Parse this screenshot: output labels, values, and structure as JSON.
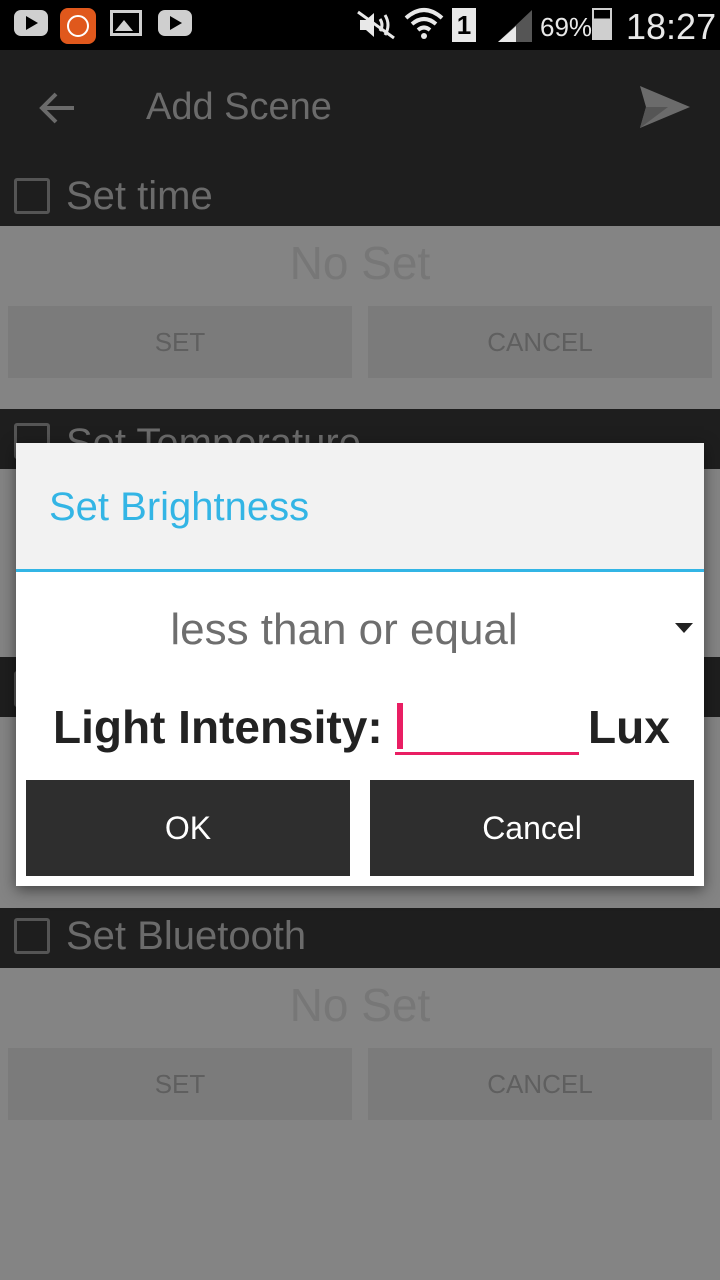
{
  "status_bar": {
    "battery_percent": "69%",
    "time": "18:27",
    "sim_slot": "1",
    "icons": [
      "youtube-icon",
      "mi-icon",
      "image-icon",
      "youtube-icon",
      "mute-icon",
      "wifi-icon",
      "sim-icon",
      "signal-icon",
      "battery-icon"
    ]
  },
  "app_bar": {
    "title": "Add Scene",
    "back_icon": "back-arrow-icon",
    "send_icon": "send-icon"
  },
  "sections": [
    {
      "title": "Set time",
      "value": "No Set",
      "set_label": "SET",
      "cancel_label": "CANCEL"
    },
    {
      "title": "Set Temperature"
    },
    {
      "title": "Set Bluetooth",
      "value": "No Set",
      "set_label": "SET",
      "cancel_label": "CANCEL"
    }
  ],
  "dialog": {
    "title": "Set Brightness",
    "comparator": "less than or equal",
    "label": "Light Intensity:",
    "input_value": "",
    "unit": "Lux",
    "ok_label": "OK",
    "cancel_label": "Cancel"
  },
  "colors": {
    "accent": "#33b5e5",
    "input_underline": "#e91e63",
    "dialog_button": "#2e2e2e",
    "app_bar": "#1e1e1e"
  }
}
